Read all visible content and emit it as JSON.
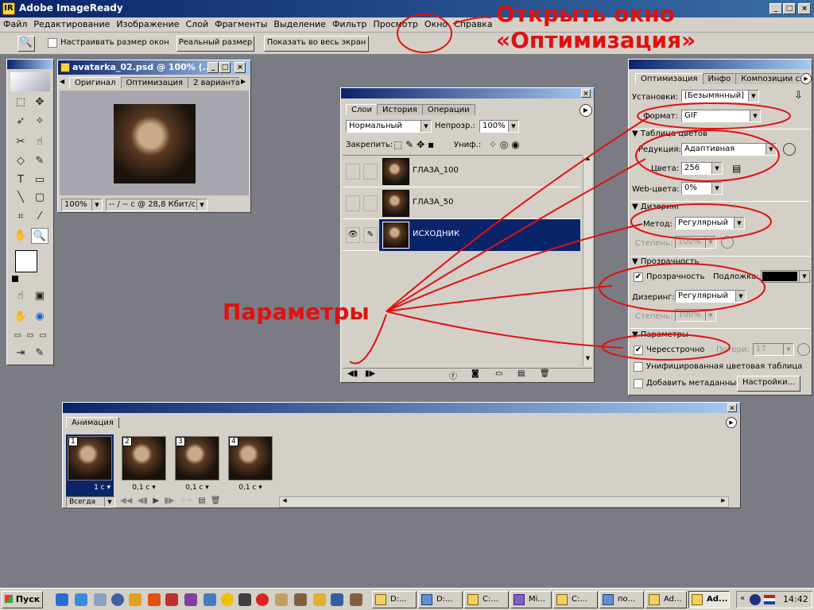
{
  "app": {
    "title": "Adobe ImageReady",
    "window_buttons": [
      "_",
      "□",
      "×"
    ]
  },
  "menu": [
    "Файл",
    "Редактирование",
    "Изображение",
    "Слой",
    "Фрагменты",
    "Выделение",
    "Фильтр",
    "Просмотр",
    "Окно",
    "Справка"
  ],
  "options_bar": {
    "resize_windows_label": "Настраивать размер окон",
    "resize_windows_checked": false,
    "actual_size_button": "Реальный размер",
    "fit_screen_button": "Показать во весь экран"
  },
  "document": {
    "title": "avatarka_02.psd @ 100% (...",
    "tabs": [
      "Оригинал",
      "Оптимизация",
      "2 варианта"
    ],
    "active_tab": "Оригинал",
    "zoom": "100%",
    "status": "-- / -- с @ 28,8 Кбит/с"
  },
  "layers_panel": {
    "tabs": [
      "Слои",
      "История",
      "Операции"
    ],
    "active_tab": "Слои",
    "blend_mode": "Нормальный",
    "opacity_label": "Непрозр.:",
    "opacity": "100%",
    "lock_label": "Закрепить:",
    "unify_label": "Униф.:",
    "layers": [
      {
        "name": "ГЛАЗА_100",
        "visible": false,
        "selected": false
      },
      {
        "name": "ГЛАЗА_50",
        "visible": false,
        "selected": false
      },
      {
        "name": "ИСХОДНИК",
        "visible": true,
        "selected": true
      }
    ]
  },
  "optimize_panel": {
    "tabs": [
      "Оптимизация",
      "Инфо",
      "Композиции слое"
    ],
    "active_tab": "Оптимизация",
    "settings_label": "Установки:",
    "settings_value": "[Безымянный]",
    "format_label": "Формат:",
    "format_value": "GIF",
    "color_table_section": "Таблица цветов",
    "reduction_label": "Редукция:",
    "reduction_value": "Адаптивная",
    "colors_label": "Цвета:",
    "colors_value": "256",
    "web_colors_label": "Web-цвета:",
    "web_colors_value": "0%",
    "dither_section": "Дизеринг",
    "method_label": "Метод:",
    "method_value": "Регулярный",
    "amount_label": "Степень:",
    "amount_value": "100%",
    "transparency_section": "Прозрачность",
    "transparency_label": "Прозрачность",
    "transparency_checked": true,
    "matte_label": "Подложка:",
    "matte_color": "#000000",
    "t_dither_label": "Дизеринг:",
    "t_dither_value": "Регулярный",
    "t_amount_label": "Степень:",
    "t_amount_value": "100%",
    "options_section": "Параметры",
    "interlaced_label": "Чересстрочно",
    "interlaced_checked": true,
    "lossy_label": "Потери:",
    "lossy_value": "17",
    "unified_label": "Унифицированная цветовая таблица",
    "unified_checked": false,
    "metadata_label": "Добавить метаданные",
    "metadata_checked": false,
    "settings_button": "Настройки..."
  },
  "animation_panel": {
    "tab": "Анимация",
    "loop_value": "Всегда",
    "frames": [
      {
        "num": "1",
        "delay": "1 с",
        "selected": true
      },
      {
        "num": "2",
        "delay": "0,1 с",
        "selected": false
      },
      {
        "num": "3",
        "delay": "0,1 с",
        "selected": false
      },
      {
        "num": "4",
        "delay": "0,1 с",
        "selected": false
      }
    ]
  },
  "annotations": {
    "open_window_line1": "Открыть окно",
    "open_window_line2": "«Оптимизация»",
    "parameters": "Параметры",
    "color": "#e01010"
  },
  "taskbar": {
    "start_label": "Пуск",
    "tasks": [
      "D:...",
      "D:...",
      "C:...",
      "Mi...",
      "C:...",
      "по...",
      "Ad...",
      "Ad..."
    ],
    "active_task": "Ad...",
    "clock": "14:42"
  }
}
